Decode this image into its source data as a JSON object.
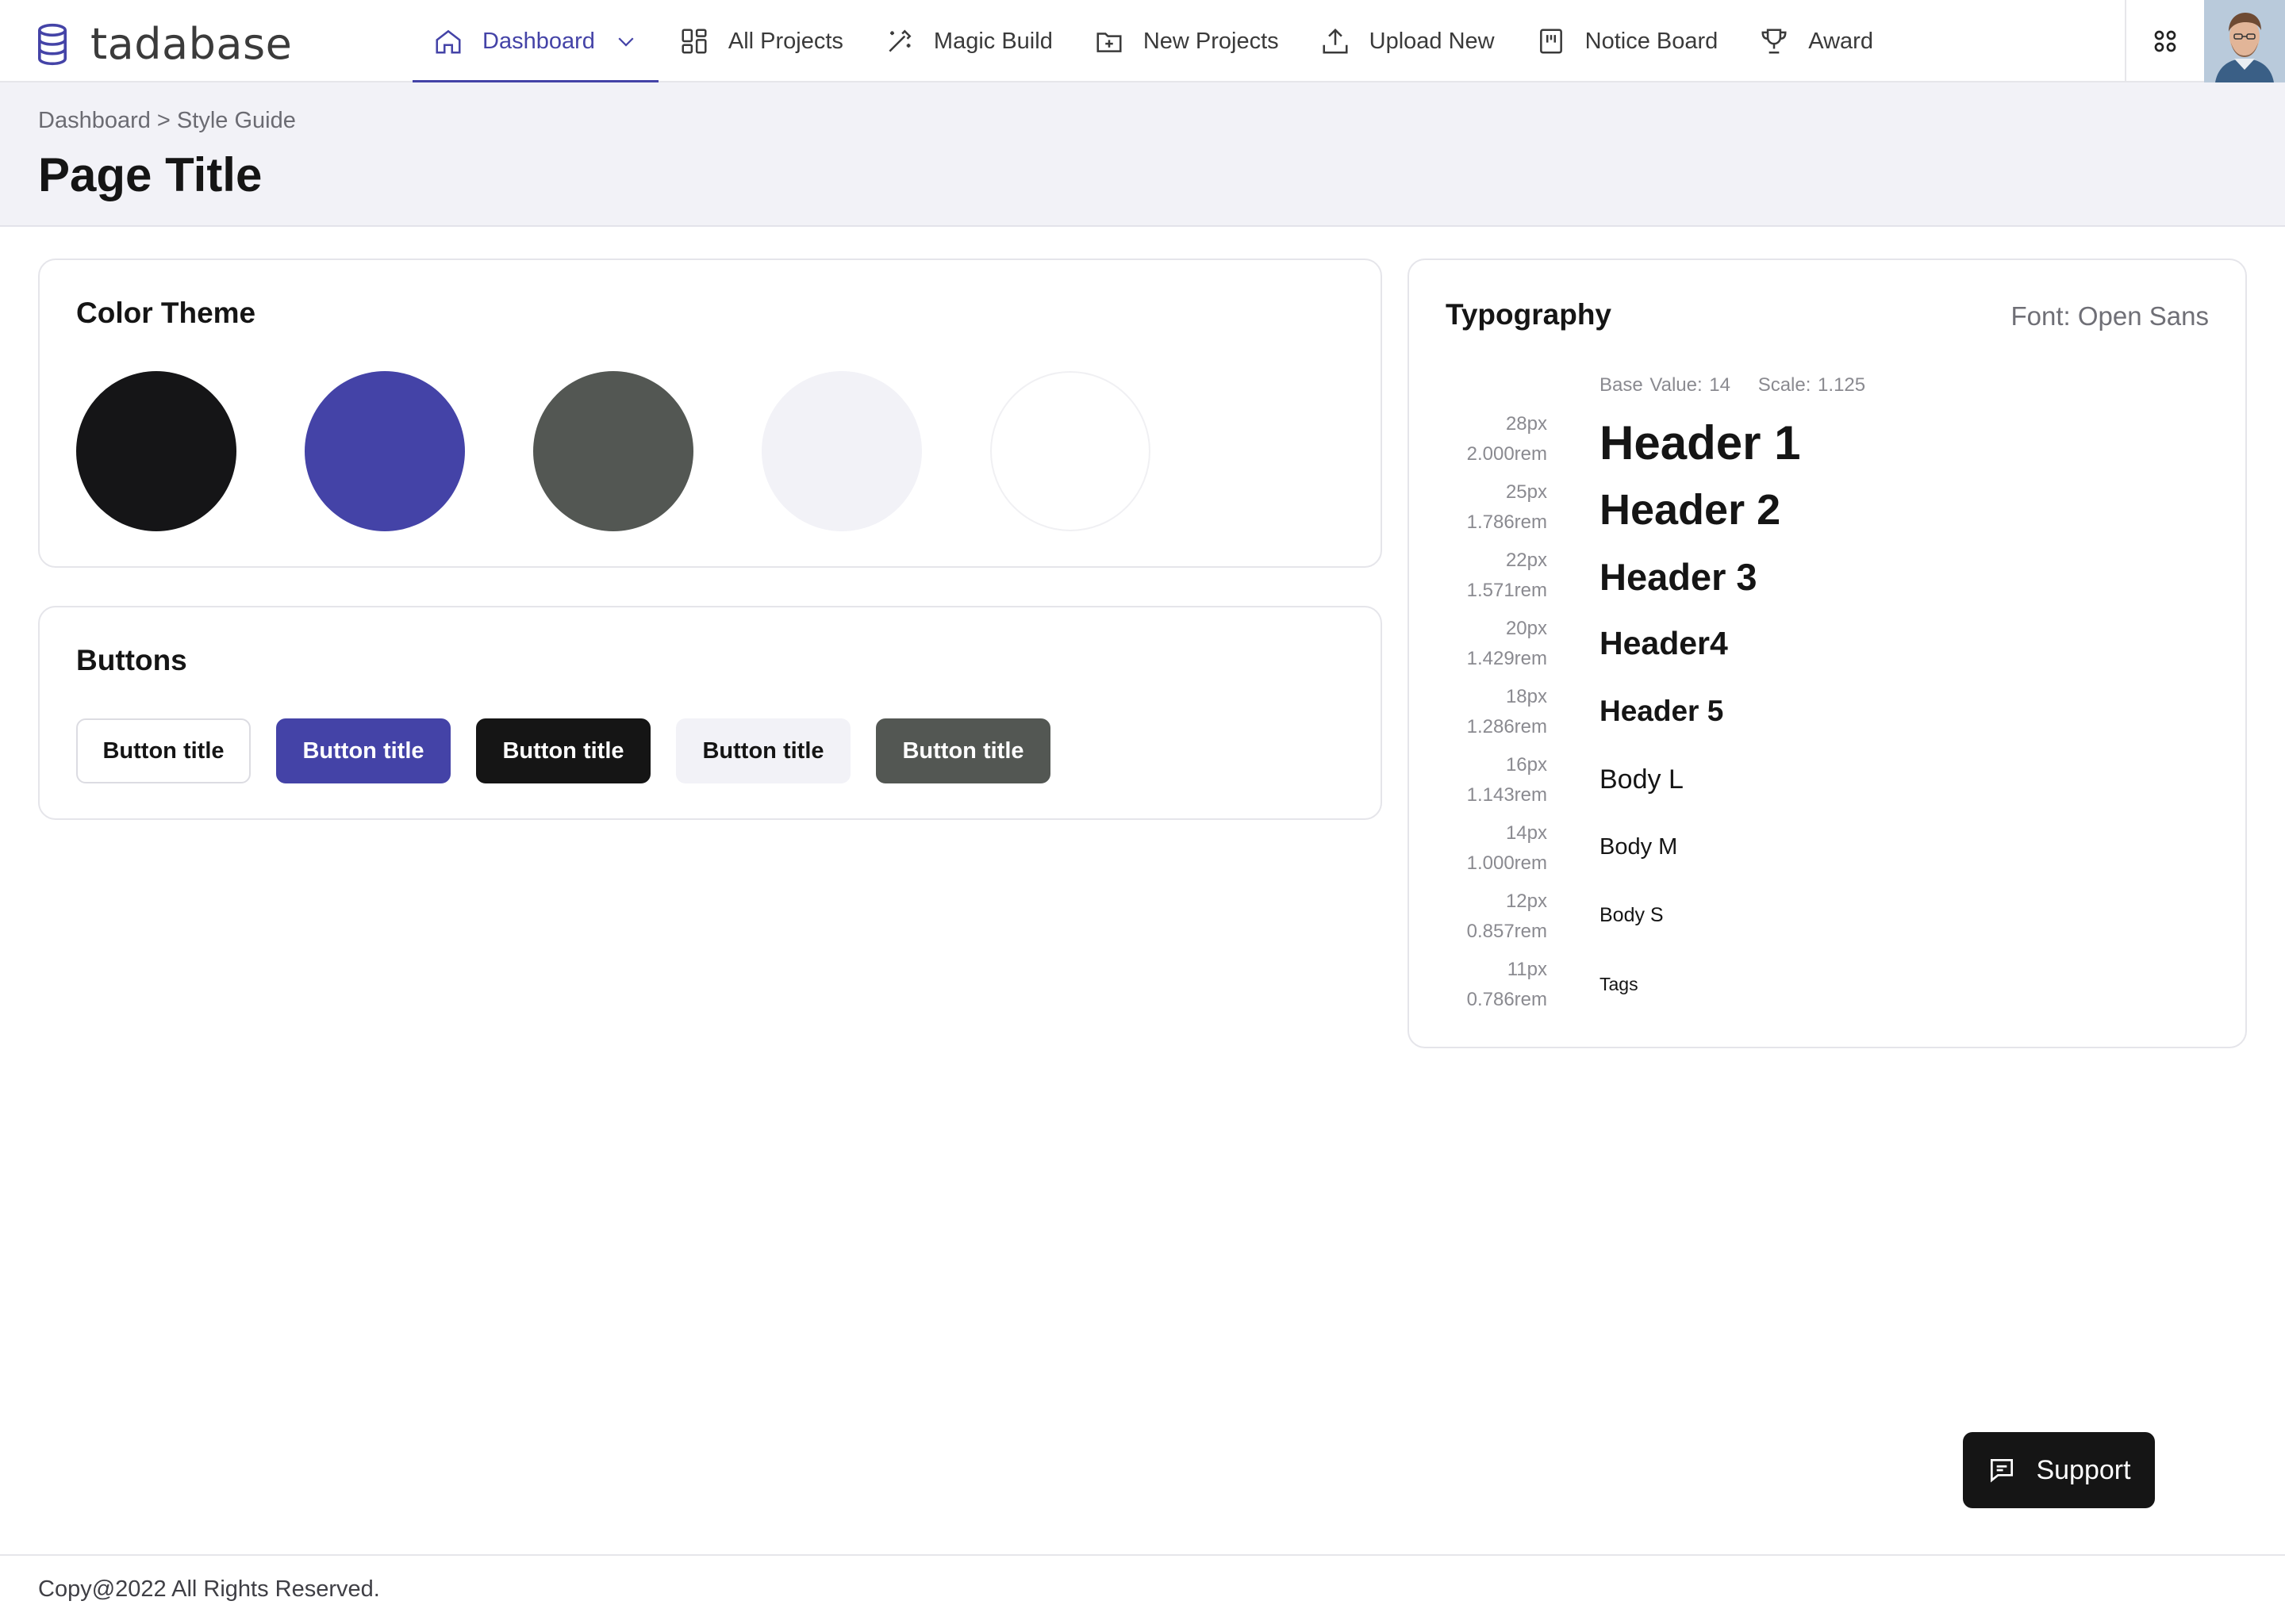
{
  "app": {
    "logo_text": "tadabase"
  },
  "nav": {
    "items": [
      {
        "label": "Dashboard",
        "icon": "home-icon",
        "active": true
      },
      {
        "label": "All Projects",
        "icon": "grid-icon"
      },
      {
        "label": "Magic Build",
        "icon": "magic-wand-icon"
      },
      {
        "label": "New Projects",
        "icon": "folder-plus-icon"
      },
      {
        "label": "Upload New",
        "icon": "upload-icon"
      },
      {
        "label": "Notice Board",
        "icon": "board-icon"
      },
      {
        "label": "Award",
        "icon": "trophy-icon"
      }
    ],
    "apps_icon": "apps-grid-icon"
  },
  "page": {
    "breadcrumb": "Dashboard > Style Guide",
    "title": "Page Title"
  },
  "color_theme": {
    "title": "Color Theme",
    "swatches": [
      "#151517",
      "#4443a7",
      "#535753",
      "#f2f2f7",
      "#ffffff"
    ]
  },
  "buttons": {
    "title": "Buttons",
    "items": [
      {
        "label": "Button title",
        "bg": "#ffffff",
        "fg": "#151515",
        "border": "#dcdce2"
      },
      {
        "label": "Button title",
        "bg": "#4443a7",
        "fg": "#ffffff",
        "border": "#4443a7"
      },
      {
        "label": "Button title",
        "bg": "#151515",
        "fg": "#ffffff",
        "border": "#151515"
      },
      {
        "label": "Button title",
        "bg": "#f2f2f7",
        "fg": "#151515",
        "border": "#f2f2f7"
      },
      {
        "label": "Button title",
        "bg": "#535753",
        "fg": "#ffffff",
        "border": "#535753"
      }
    ]
  },
  "typography": {
    "title": "Typography",
    "font": "Font: Open Sans",
    "base_value": "Base Value: 14",
    "scale": "Scale: 1.125",
    "rows": [
      {
        "px": "28px",
        "rem": "2.000rem",
        "label": "Header 1"
      },
      {
        "px": "25px",
        "rem": "1.786rem",
        "label": "Header 2"
      },
      {
        "px": "22px",
        "rem": "1.571rem",
        "label": "Header 3"
      },
      {
        "px": "20px",
        "rem": "1.429rem",
        "label": "Header4"
      },
      {
        "px": "18px",
        "rem": "1.286rem",
        "label": "Header 5"
      },
      {
        "px": "16px",
        "rem": "1.143rem",
        "label": "Body L"
      },
      {
        "px": "14px",
        "rem": "1.000rem",
        "label": "Body M"
      },
      {
        "px": "12px",
        "rem": "0.857rem",
        "label": "Body S"
      },
      {
        "px": "11px",
        "rem": "0.786rem",
        "label": "Tags"
      }
    ]
  },
  "support": {
    "label": "Support",
    "icon": "chat-icon"
  },
  "footer": {
    "text": "Copy@2022 All Rights Reserved."
  }
}
